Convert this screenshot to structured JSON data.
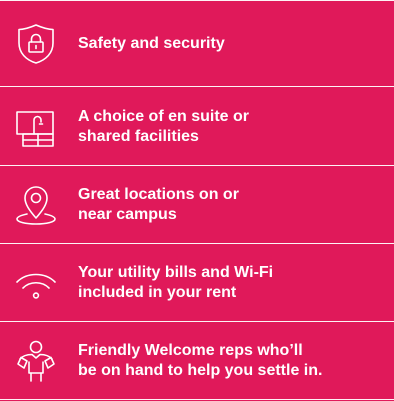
{
  "features": [
    {
      "icon": "shield-lock-icon",
      "label": "Safety and security"
    },
    {
      "icon": "bathroom-icon",
      "label": "A choice of en suite or\nshared facilities"
    },
    {
      "icon": "location-pin-icon",
      "label": "Great locations on or\nnear campus"
    },
    {
      "icon": "wifi-icon",
      "label": "Your utility bills and Wi-Fi\nincluded in your rent"
    },
    {
      "icon": "welcome-rep-icon",
      "label": "Friendly Welcome reps who’ll\nbe on hand to help you settle in."
    }
  ],
  "colors": {
    "background": "#e0195a",
    "foreground": "#ffffff"
  }
}
